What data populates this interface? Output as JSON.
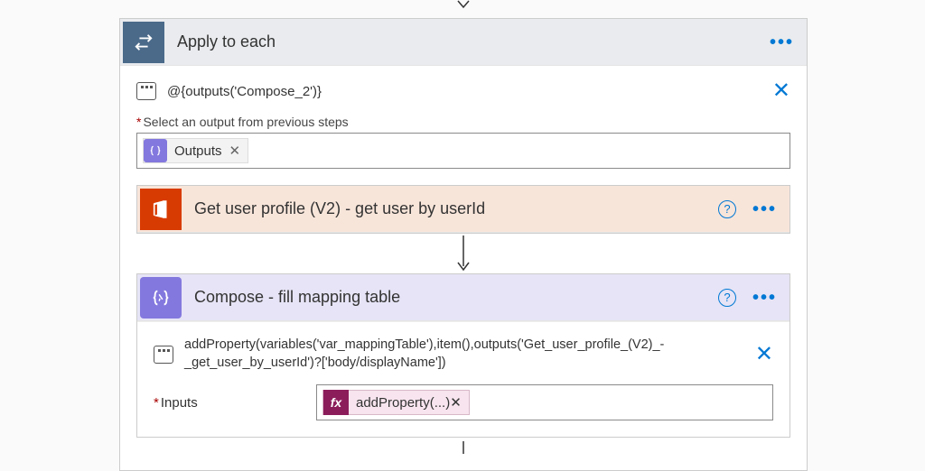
{
  "apply_to_each": {
    "title": "Apply to each",
    "peek_code": "@{outputs('Compose_2')}",
    "select_label": "Select an output from previous steps",
    "outputs_token": "Outputs"
  },
  "get_user": {
    "title": "Get user profile (V2) - get user by userId"
  },
  "compose": {
    "title": "Compose - fill mapping table",
    "peek_code": "addProperty(variables('var_mappingTable'),item(),outputs('Get_user_profile_(V2)_-_get_user_by_userId')?['body/displayName'])",
    "inputs_label": "Inputs",
    "fx_token": "addProperty(...)"
  }
}
